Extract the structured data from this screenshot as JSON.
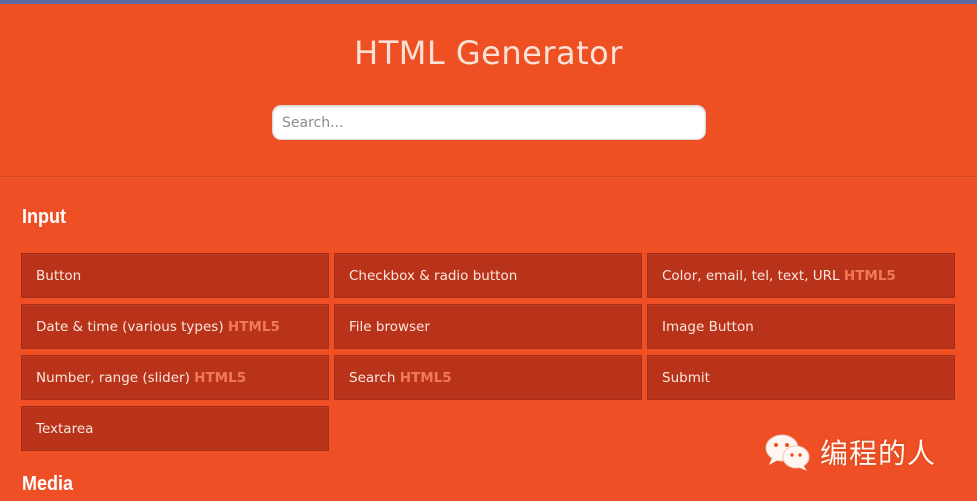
{
  "header": {
    "title": "HTML Generator",
    "search_placeholder": "Search..."
  },
  "sections": [
    {
      "title": "Input",
      "items": [
        {
          "label": "Button",
          "badge": ""
        },
        {
          "label": "Checkbox & radio button",
          "badge": ""
        },
        {
          "label": "Color, email, tel, text, URL",
          "badge": "HTML5"
        },
        {
          "label": "Date & time (various types)",
          "badge": "HTML5"
        },
        {
          "label": "File browser",
          "badge": ""
        },
        {
          "label": "Image Button",
          "badge": ""
        },
        {
          "label": "Number, range (slider)",
          "badge": "HTML5"
        },
        {
          "label": "Search",
          "badge": "HTML5"
        },
        {
          "label": "Submit",
          "badge": ""
        },
        {
          "label": "Textarea",
          "badge": ""
        }
      ]
    },
    {
      "title": "Media",
      "items": []
    }
  ],
  "watermark": {
    "text": "编程的人",
    "icon": "wechat-icon"
  },
  "colors": {
    "background": "#ee5024",
    "item_background": "#b9331a",
    "badge": "#f07a57",
    "top_strip": "#5b6aa2"
  }
}
